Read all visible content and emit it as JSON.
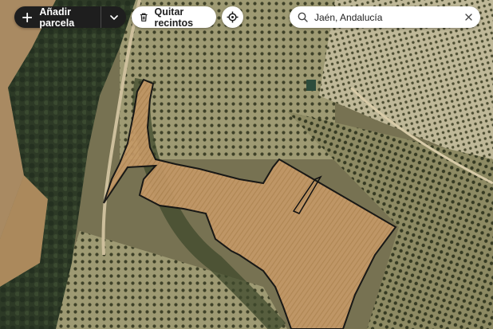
{
  "toolbar": {
    "add_parcel_label": "Añadir parcela",
    "remove_enclosures_label": "Quitar recintos"
  },
  "search": {
    "value": "Jaén, Andalucía",
    "placeholder": ""
  },
  "icons": {
    "add": "plus-icon",
    "dropdown": "chevron-down-icon",
    "remove": "trash-icon",
    "locate": "locate-icon",
    "search": "search-icon",
    "clear": "close-icon"
  },
  "colors": {
    "parcel_fill": "#c69a68",
    "parcel_outline": "#111111",
    "button_dark": "#1e1e1e",
    "button_light": "#ffffff"
  }
}
